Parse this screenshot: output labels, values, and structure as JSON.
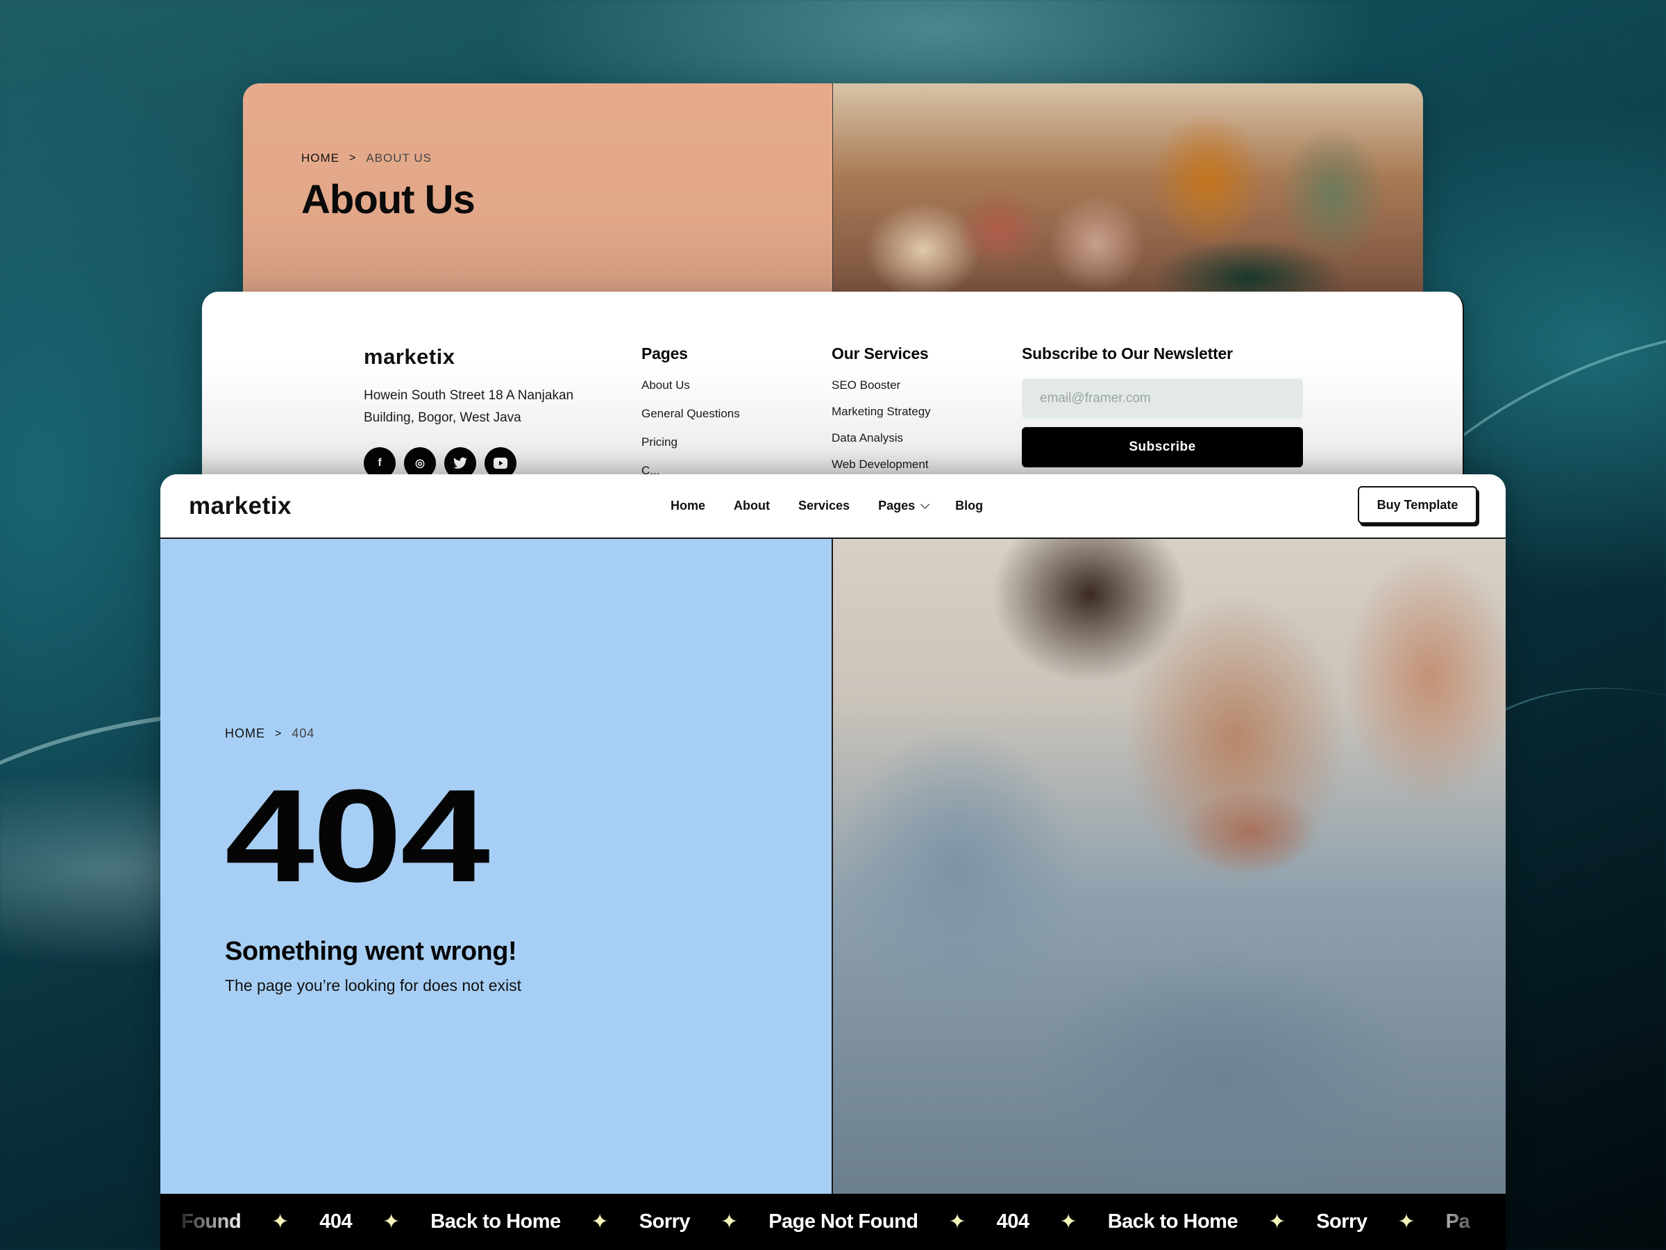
{
  "about_page": {
    "breadcrumb": {
      "home": "HOME",
      "separator": ">",
      "current": "ABOUT US"
    },
    "title": "About Us",
    "photo_alt": "group-of-people-chatting-photo"
  },
  "footer": {
    "logo": "marketix",
    "address": "Howein South Street 18 A Nanjakan Building, Bogor, West Java",
    "socials": [
      {
        "icon": "facebook-icon",
        "glyph": "f"
      },
      {
        "icon": "instagram-icon",
        "glyph": "◎"
      },
      {
        "icon": "twitter-icon",
        "glyph": "🐦"
      },
      {
        "icon": "youtube-icon",
        "glyph": "▶"
      }
    ],
    "pages": {
      "heading": "Pages",
      "items": [
        "About Us",
        "General Questions",
        "Pricing",
        "C..."
      ]
    },
    "services": {
      "heading": "Our Services",
      "items": [
        "SEO Booster",
        "Marketing Strategy",
        "Data Analysis",
        "Web Development"
      ]
    },
    "newsletter": {
      "heading": "Subscribe to Our Newsletter",
      "email_placeholder": "email@framer.com",
      "email_value": "",
      "button": "Subscribe"
    }
  },
  "navbar": {
    "logo": "marketix",
    "links": [
      "Home",
      "About",
      "Services",
      "Pages",
      "Blog"
    ],
    "cta": "Buy Template"
  },
  "error_page": {
    "breadcrumb": {
      "home": "HOME",
      "separator": ">",
      "current": "404"
    },
    "code": "404",
    "title": "Something went wrong!",
    "subtitle": "The page you’re looking for does not exist",
    "photo_alt": "distressed-woman-in-sweater-photo",
    "background_color": "#a7cff5"
  },
  "ticker": {
    "star_glyph": "✦",
    "items": [
      "Found",
      "404",
      "Back to Home",
      "Sorry",
      "Page Not Found",
      "404",
      "Back to Home",
      "Sorry",
      "Pa"
    ],
    "star_color": "#f4f4b8"
  }
}
